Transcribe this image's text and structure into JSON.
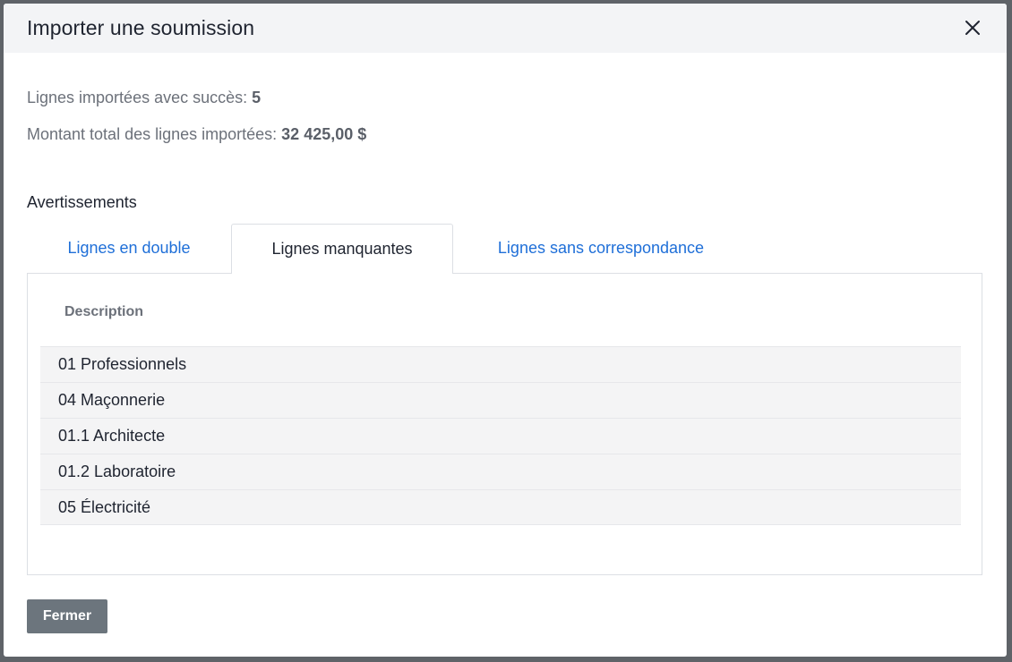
{
  "modal": {
    "title": "Importer une soumission",
    "close_icon": "close-icon"
  },
  "summary": {
    "imported_label": "Lignes importées avec succès:",
    "imported_count": "5",
    "total_label": "Montant total des lignes importées:",
    "total_amount": "32 425,00 $"
  },
  "warnings": {
    "title": "Avertissements",
    "tabs": [
      {
        "label": "Lignes en double",
        "active": false
      },
      {
        "label": "Lignes manquantes",
        "active": true
      },
      {
        "label": "Lignes sans correspondance",
        "active": false
      }
    ],
    "table": {
      "column": "Description",
      "rows": [
        "01 Professionnels",
        "04 Maçonnerie",
        "01.1 Architecte",
        "01.2 Laboratoire",
        "05 Électricité"
      ]
    }
  },
  "footer": {
    "close_label": "Fermer"
  },
  "colors": {
    "accent_link": "#1f6fd8",
    "button_bg": "#6c757d",
    "header_bg": "#f3f4f6"
  }
}
